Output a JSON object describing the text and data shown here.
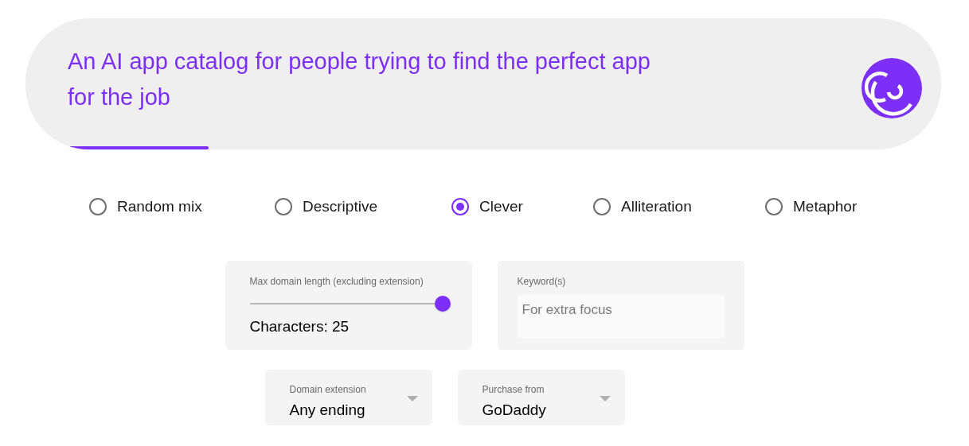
{
  "header": {
    "tagline": "An AI app catalog for people trying to find the perfect app for the job",
    "progress": {
      "level": 0.2
    }
  },
  "styles": [
    {
      "label": "Random mix",
      "selected": false
    },
    {
      "label": "Descriptive",
      "selected": false
    },
    {
      "label": "Clever",
      "selected": true
    },
    {
      "label": "Alliteration",
      "selected": false
    },
    {
      "label": "Metaphor",
      "selected": false
    }
  ],
  "length": {
    "label": "Max domain length (excluding extension)",
    "level": 1,
    "reading": "Characters: 25"
  },
  "keywords": {
    "label": "Keyword(s)",
    "placeholder": "For extra focus"
  },
  "dropdowns": [
    {
      "label": "Domain extension",
      "value": "Any ending"
    },
    {
      "label": "Purchase from",
      "value": "GoDaddy"
    }
  ]
}
